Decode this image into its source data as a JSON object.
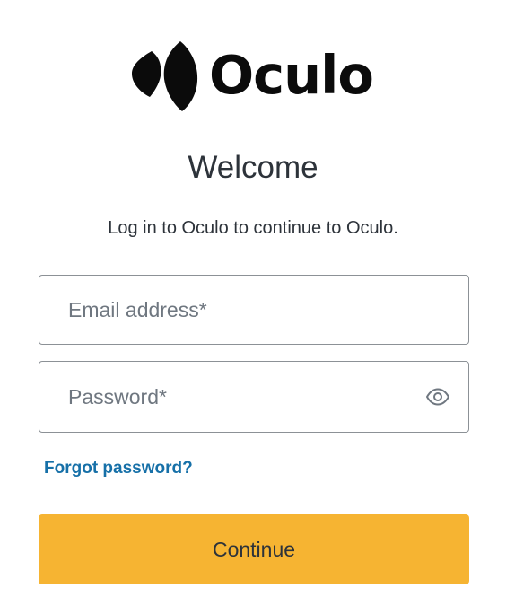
{
  "brand": {
    "name": "Oculo",
    "logo_icon": "oculo-leaf-mark-icon",
    "logo_color": "#0b0b0b"
  },
  "heading": {
    "title": "Welcome",
    "subtitle": "Log in to Oculo to continue to Oculo."
  },
  "form": {
    "email": {
      "placeholder": "Email address*",
      "value": ""
    },
    "password": {
      "placeholder": "Password*",
      "value": "",
      "toggle_icon": "eye-icon"
    },
    "forgot_password_label": "Forgot password?",
    "continue_label": "Continue"
  },
  "colors": {
    "primary_button": "#f6b432",
    "link": "#1670a8",
    "text": "#2d333a",
    "field_border": "#8c9196"
  }
}
